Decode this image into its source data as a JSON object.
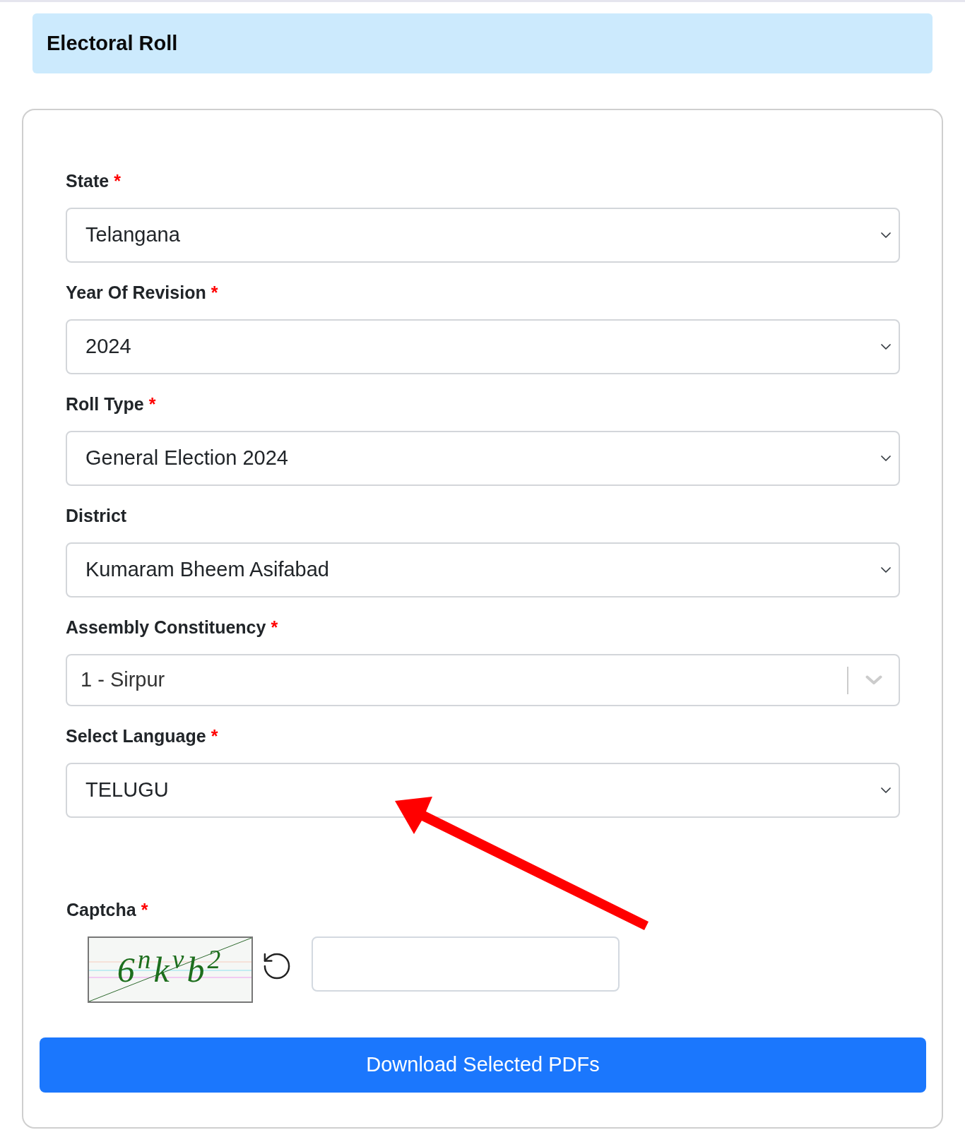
{
  "header": {
    "title": "Electoral Roll"
  },
  "form": {
    "fields": [
      {
        "kind": "select",
        "label": "State",
        "required_mark": "*",
        "value": "Telangana"
      },
      {
        "kind": "select",
        "label": "Year Of Revision",
        "required_mark": "*",
        "value": "2024"
      },
      {
        "kind": "select",
        "label": "Roll Type",
        "required_mark": "*",
        "value": "General Election 2024"
      },
      {
        "kind": "select",
        "label": "District",
        "value": "Kumaram Bheem Asifabad"
      },
      {
        "kind": "searchable_select",
        "label": "Assembly Constituency",
        "required_mark": "*",
        "value": "1 - Sirpur"
      },
      {
        "kind": "select",
        "label": "Select Language",
        "required_mark": "*",
        "value": "TELUGU"
      }
    ],
    "captcha": {
      "label": "Captcha",
      "required_mark": "*",
      "image_text": "6$^{n}$k$^{v}$b$^{2}$"
    },
    "submit_button": "Download Selected PDFs"
  }
}
